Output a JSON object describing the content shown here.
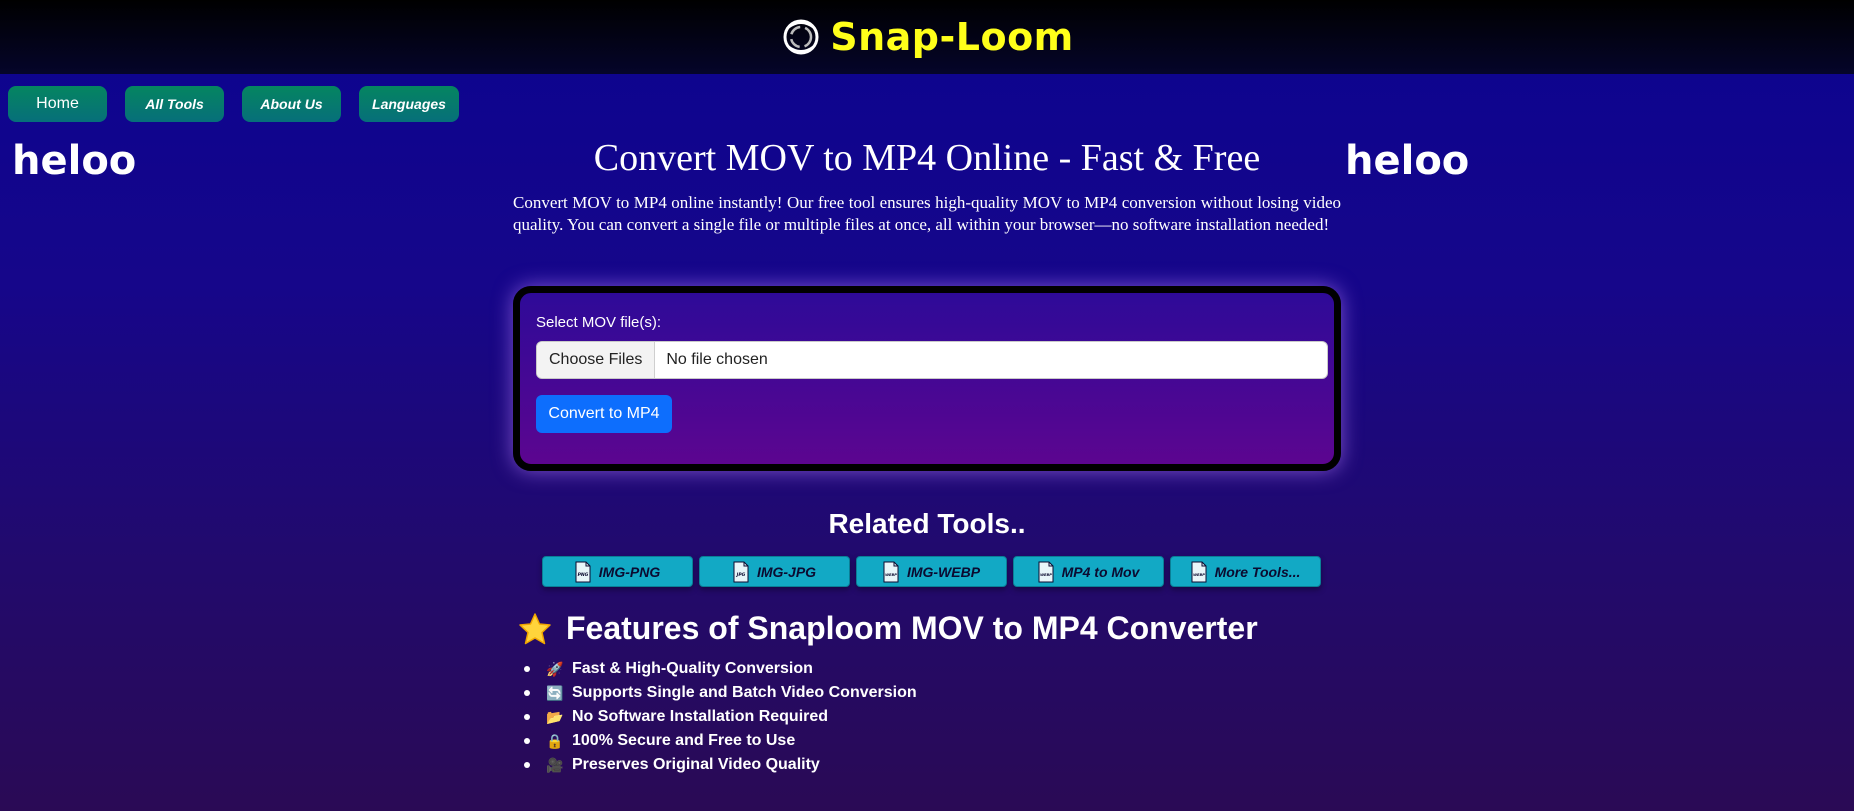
{
  "header": {
    "brand_title": "Snap-Loom",
    "logo_icon": "swirl-logo-icon"
  },
  "nav": {
    "items": [
      {
        "label": "Home"
      },
      {
        "label": "All Tools"
      },
      {
        "label": "About Us"
      },
      {
        "label": "Languages"
      }
    ]
  },
  "side": {
    "left_text": "heloo",
    "right_text": "heloo"
  },
  "main": {
    "title": "Convert MOV to MP4 Online - Fast & Free",
    "intro": "Convert MOV to MP4 online instantly! Our free tool ensures high-quality MOV to MP4 conversion without losing video quality. You can convert a single file or multiple files at once, all within your browser—no software installation needed!"
  },
  "converter": {
    "file_label": "Select MOV file(s):",
    "choose_button": "Choose Files",
    "file_status": "No file chosen",
    "convert_button": "Convert to MP4"
  },
  "related": {
    "title": "Related Tools..",
    "tools": [
      {
        "label": "IMG-PNG",
        "icon": "png-file-icon",
        "tag": "PNG"
      },
      {
        "label": "IMG-JPG",
        "icon": "jpg-file-icon",
        "tag": "JPG"
      },
      {
        "label": "IMG-WEBP",
        "icon": "webp-file-icon",
        "tag": "WEBP"
      },
      {
        "label": "MP4 to Mov",
        "icon": "webp-file-icon",
        "tag": "WEBP"
      },
      {
        "label": "More Tools...",
        "icon": "webp-file-icon",
        "tag": "WEBP"
      }
    ]
  },
  "features": {
    "title": "Features of Snaploom MOV to MP4 Converter",
    "title_icon": "star-icon",
    "items": [
      {
        "icon": "🚀",
        "text": "Fast & High-Quality Conversion"
      },
      {
        "icon": "🔄",
        "text": "Supports Single and Batch Video Conversion"
      },
      {
        "icon": "📂",
        "text": "No Software Installation Required"
      },
      {
        "icon": "🔒",
        "text": "100% Secure and Free to Use"
      },
      {
        "icon": "🎥",
        "text": "Preserves Original Video Quality"
      }
    ]
  },
  "colors": {
    "brand": "#ffff1a",
    "nav_green": "#058560",
    "primary_button": "#0d6efd",
    "tool_button": "#12a9c5"
  }
}
